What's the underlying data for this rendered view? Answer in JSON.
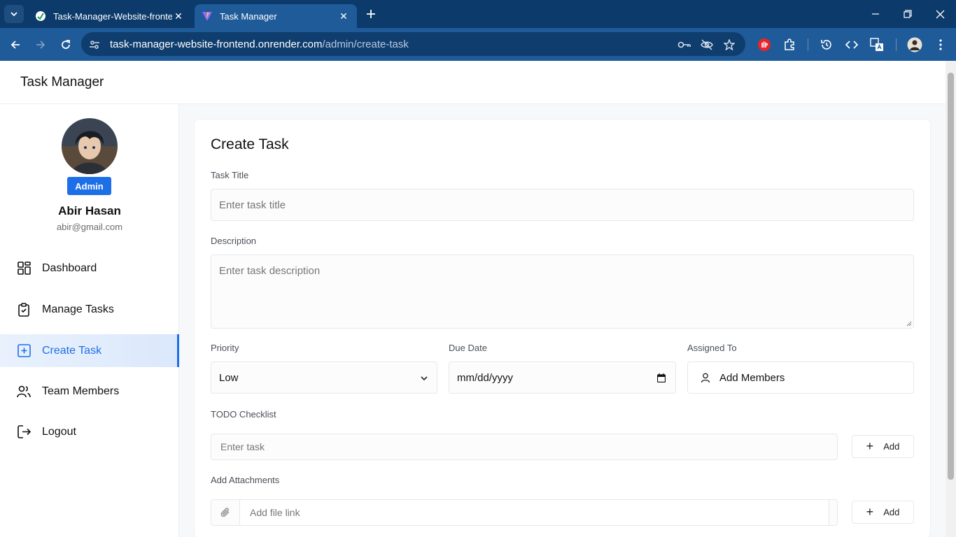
{
  "browser": {
    "tabs": [
      {
        "title": "Task-Manager-Website-frontend"
      },
      {
        "title": "Task Manager"
      }
    ],
    "url": {
      "host": "task-manager-website-frontend.onrender.com",
      "path": "/admin/create-task"
    }
  },
  "app": {
    "title": "Task Manager"
  },
  "sidebar": {
    "role_badge": "Admin",
    "user_name": "Abir Hasan",
    "user_email": "abir@gmail.com",
    "items": [
      {
        "label": "Dashboard",
        "icon": "dashboard-icon"
      },
      {
        "label": "Manage Tasks",
        "icon": "clipboard-check-icon"
      },
      {
        "label": "Create Task",
        "icon": "square-plus-icon",
        "active": true
      },
      {
        "label": "Team Members",
        "icon": "users-icon"
      },
      {
        "label": "Logout",
        "icon": "logout-icon"
      }
    ]
  },
  "form": {
    "heading": "Create Task",
    "title_label": "Task Title",
    "title_placeholder": "Enter task title",
    "description_label": "Description",
    "description_placeholder": "Enter task description",
    "priority_label": "Priority",
    "priority_value": "Low",
    "due_label": "Due Date",
    "due_value": "mm/dd/yyyy",
    "assigned_label": "Assigned To",
    "assigned_button": "Add Members",
    "todo_label": "TODO Checklist",
    "todo_placeholder": "Enter task",
    "todo_add": "Add",
    "attach_label": "Add Attachments",
    "attach_placeholder": "Add file link",
    "attach_add": "Add"
  },
  "colors": {
    "accent": "#1d6fe8",
    "chrome_dark": "#0b3a6b",
    "chrome": "#1f5a99"
  }
}
